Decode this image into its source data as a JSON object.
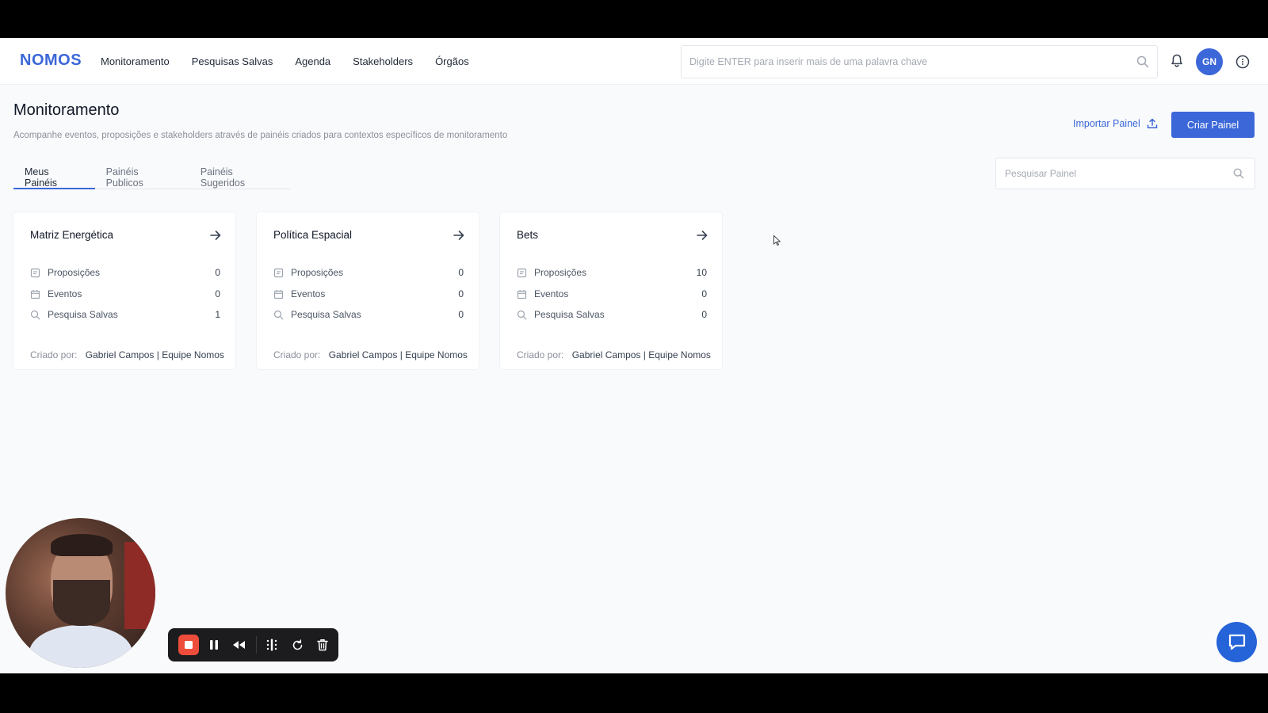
{
  "app": {
    "logo": "NOMOS",
    "nav": [
      "Monitoramento",
      "Pesquisas Salvas",
      "Agenda",
      "Stakeholders",
      "Órgãos"
    ],
    "search_placeholder": "Digite ENTER para inserir mais de uma palavra chave",
    "user_initials": "GN"
  },
  "page": {
    "title": "Monitoramento",
    "subtitle": "Acompanhe eventos, proposições e stakeholders através de painéis criados para contextos específicos de monitoramento",
    "import_label": "Importar Painel",
    "create_label": "Criar Painel",
    "tabs": [
      "Meus Painéis",
      "Painéis Publicos",
      "Painéis Sugeridos"
    ],
    "active_tab": "Meus Painéis",
    "panel_search_placeholder": "Pesquisar Painel"
  },
  "cards": [
    {
      "title": "Matriz Energética",
      "stats": [
        {
          "label": "Proposições",
          "value": "0",
          "icon": "document-icon"
        },
        {
          "label": "Eventos",
          "value": "0",
          "icon": "calendar-icon"
        },
        {
          "label": "Pesquisa Salvas",
          "value": "1",
          "icon": "search-icon"
        }
      ],
      "creator_label": "Criado por:",
      "creator_name": "Gabriel Campos | Equipe Nomos"
    },
    {
      "title": "Política Espacial",
      "stats": [
        {
          "label": "Proposições",
          "value": "0",
          "icon": "document-icon"
        },
        {
          "label": "Eventos",
          "value": "0",
          "icon": "calendar-icon"
        },
        {
          "label": "Pesquisa Salvas",
          "value": "0",
          "icon": "search-icon"
        }
      ],
      "creator_label": "Criado por:",
      "creator_name": "Gabriel Campos | Equipe Nomos"
    },
    {
      "title": "Bets",
      "stats": [
        {
          "label": "Proposições",
          "value": "10",
          "icon": "document-icon"
        },
        {
          "label": "Eventos",
          "value": "0",
          "icon": "calendar-icon"
        },
        {
          "label": "Pesquisa Salvas",
          "value": "0",
          "icon": "search-icon"
        }
      ],
      "creator_label": "Criado por:",
      "creator_name": "Gabriel Campos | Equipe Nomos"
    }
  ],
  "colors": {
    "accent": "#3b67d8",
    "record_stop": "#ee4d3b",
    "chat": "#2563d8"
  }
}
